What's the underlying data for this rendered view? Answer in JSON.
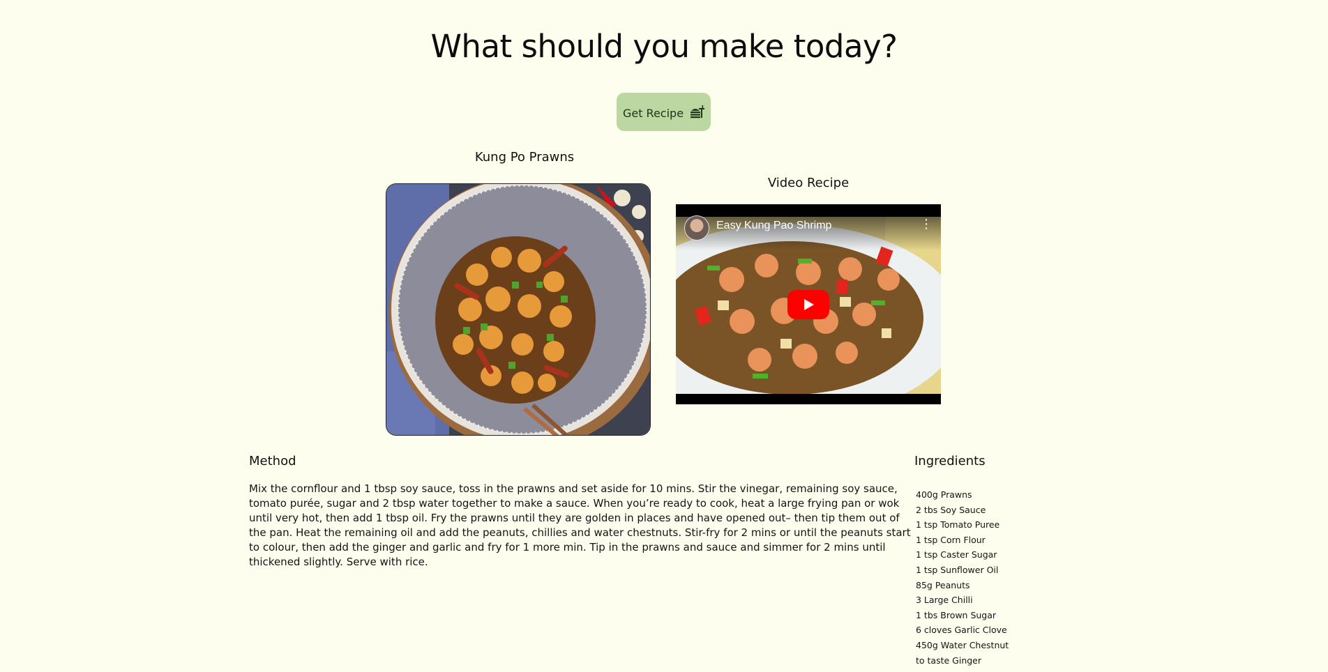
{
  "header": {
    "title": "What should you make today?"
  },
  "get_recipe": {
    "label": "Get Recipe"
  },
  "meal": {
    "name": "Kung Po Prawns",
    "image_icon": "dish-photo"
  },
  "video": {
    "heading": "Video Recipe",
    "title": "Easy Kung Pao Shrimp",
    "menu_glyph": "⋮"
  },
  "method": {
    "title": "Method",
    "text": "Mix the cornflour and 1 tbsp soy sauce, toss in the prawns and set aside for 10 mins. Stir the vinegar, remaining soy sauce, tomato purée, sugar and 2 tbsp water together to make a sauce. When you’re ready to cook, heat a large frying pan or wok until very hot, then add 1 tbsp oil. Fry the prawns until they are golden in places and have opened out– then tip them out of the pan. Heat the remaining oil and add the peanuts, chillies and water chestnuts. Stir-fry for 2 mins or until the peanuts start to colour, then add the ginger and garlic and fry for 1 more min. Tip in the prawns and sauce and simmer for 2 mins until thickened slightly. Serve with rice."
  },
  "ingredients": {
    "title": "Ingredients",
    "items": [
      "400g Prawns",
      "2 tbs Soy Sauce",
      "1 tsp Tomato Puree",
      "1 tsp Corn Flour",
      "1 tsp Caster Sugar",
      "1 tsp Sunflower Oil",
      "85g Peanuts",
      "3 Large Chilli",
      "1 tbs Brown Sugar",
      "6 cloves Garlic Clove",
      "450g Water Chestnut",
      "to taste Ginger"
    ]
  },
  "colors": {
    "background": "#fefeee",
    "button": "#bcd7a1",
    "play_button": "#ff0000"
  }
}
